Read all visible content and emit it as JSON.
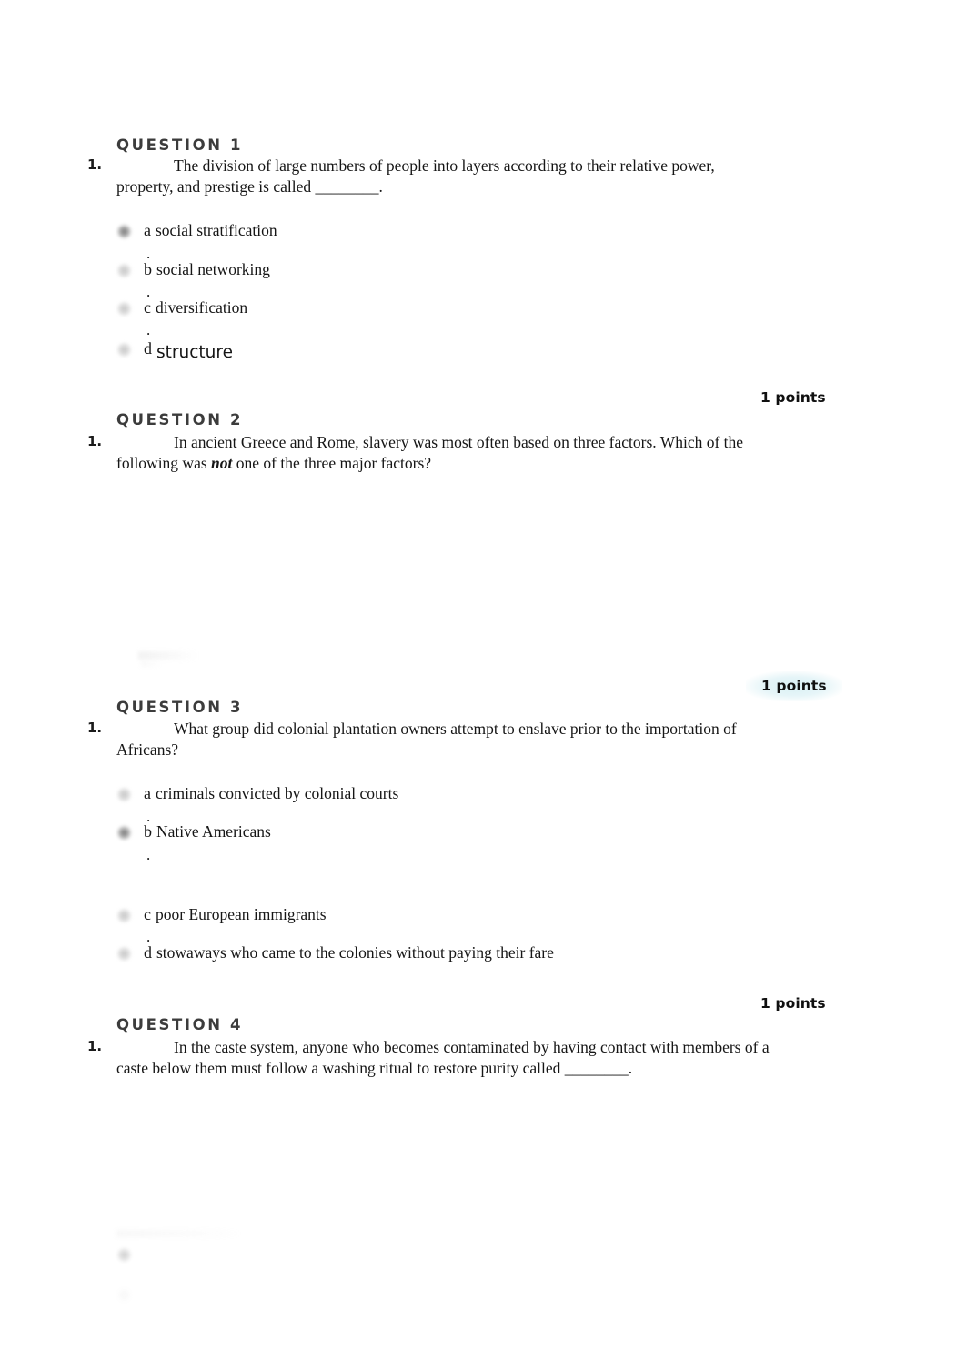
{
  "document": {
    "kind": "online-quiz-printout",
    "background_color": "#ffffff",
    "heading_color": "#3c3c3c",
    "text_color": "#161616",
    "highlight_color": "#d8f0f4"
  },
  "questions": [
    {
      "heading": "QUESTION 1",
      "number": "1.",
      "text_part1": "The division of large numbers of people into layers according to their relative power, property, and prestige is called ________.",
      "points": "1 points",
      "points_highlighted": false,
      "options": [
        {
          "letter": "a",
          "dot": ".",
          "label": "social stratification",
          "selected": true,
          "font": "serif"
        },
        {
          "letter": "b",
          "dot": ".",
          "label": "social networking",
          "selected": false,
          "font": "serif"
        },
        {
          "letter": "c",
          "dot": ".",
          "label": "diversification",
          "selected": false,
          "font": "serif"
        },
        {
          "letter": "d",
          "dot": ".",
          "label": "structure",
          "selected": false,
          "font": "sans"
        }
      ]
    },
    {
      "heading": "QUESTION 2",
      "number": "1.",
      "text_before_not": "In ancient Greece and Rome, slavery was most often based on three factors. Which of the following was ",
      "not_word": "not",
      "text_after_not": " one of the three major factors?",
      "points": "1 points",
      "points_highlighted": true,
      "options": []
    },
    {
      "heading": "QUESTION 3",
      "number": "1.",
      "text_part1": "What group did colonial plantation owners attempt to enslave prior to the importation of Africans?",
      "points": "1 points",
      "points_highlighted": false,
      "options": [
        {
          "letter": "a",
          "dot": ".",
          "label": "criminals convicted by colonial courts",
          "selected": false,
          "font": "serif"
        },
        {
          "letter": "b",
          "dot": ".",
          "label": "Native Americans",
          "selected": true,
          "font": "serif"
        },
        {
          "letter": "c",
          "dot": ".",
          "label": "poor European immigrants",
          "selected": false,
          "font": "serif"
        },
        {
          "letter": "d",
          "dot": "",
          "label": "stowaways who came to the colonies without paying their fare",
          "selected": false,
          "font": "serif"
        }
      ]
    },
    {
      "heading": "QUESTION 4",
      "number": "1.",
      "text_part1": "In the caste system, anyone who becomes contaminated by having contact with members of a caste below them must follow a washing ritual to restore purity called ________.",
      "points": "",
      "points_highlighted": false,
      "options": []
    }
  ]
}
